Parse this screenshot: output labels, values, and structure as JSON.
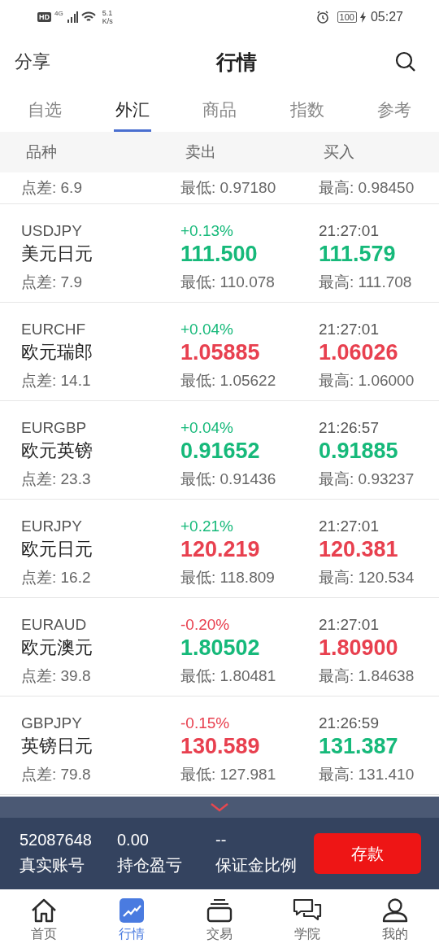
{
  "status_bar": {
    "hd": "HD",
    "network": "4G",
    "speed": "5.1",
    "speed_unit": "K/s",
    "battery": "100",
    "time": "05:27"
  },
  "header": {
    "left": "分享",
    "title": "行情"
  },
  "tabs": [
    {
      "label": "自选",
      "selected": false
    },
    {
      "label": "外汇",
      "selected": true
    },
    {
      "label": "商品",
      "selected": false
    },
    {
      "label": "指数",
      "selected": false
    },
    {
      "label": "参考",
      "selected": false
    }
  ],
  "columns": [
    "品种",
    "卖出",
    "买入"
  ],
  "partial_row": {
    "spread": "点差: 6.9",
    "low": "最低: 0.97180",
    "high": "最高: 0.98450"
  },
  "rows": [
    {
      "code": "USDJPY",
      "name": "美元日元",
      "spread": "点差: 7.9",
      "change": {
        "text": "+0.13%",
        "color": "#16b97a"
      },
      "sell": {
        "text": "111.500",
        "color": "#16b97a"
      },
      "low": "最低: 110.078",
      "time": "21:27:01",
      "buy": {
        "text": "111.579",
        "color": "#16b97a"
      },
      "high": "最高: 111.708"
    },
    {
      "code": "EURCHF",
      "name": "欧元瑞郎",
      "spread": "点差: 14.1",
      "change": {
        "text": "+0.04%",
        "color": "#16b97a"
      },
      "sell": {
        "text": "1.05885",
        "color": "#e8404f"
      },
      "low": "最低: 1.05622",
      "time": "21:27:01",
      "buy": {
        "text": "1.06026",
        "color": "#e8404f"
      },
      "high": "最高: 1.06000"
    },
    {
      "code": "EURGBP",
      "name": "欧元英镑",
      "spread": "点差: 23.3",
      "change": {
        "text": "+0.04%",
        "color": "#16b97a"
      },
      "sell": {
        "text": "0.91652",
        "color": "#16b97a"
      },
      "low": "最低: 0.91436",
      "time": "21:26:57",
      "buy": {
        "text": "0.91885",
        "color": "#16b97a"
      },
      "high": "最高: 0.93237"
    },
    {
      "code": "EURJPY",
      "name": "欧元日元",
      "spread": "点差: 16.2",
      "change": {
        "text": "+0.21%",
        "color": "#16b97a"
      },
      "sell": {
        "text": "120.219",
        "color": "#e8404f"
      },
      "low": "最低: 118.809",
      "time": "21:27:01",
      "buy": {
        "text": "120.381",
        "color": "#e8404f"
      },
      "high": "最高: 120.534"
    },
    {
      "code": "EURAUD",
      "name": "欧元澳元",
      "spread": "点差: 39.8",
      "change": {
        "text": "-0.20%",
        "color": "#e8404f"
      },
      "sell": {
        "text": "1.80502",
        "color": "#16b97a"
      },
      "low": "最低: 1.80481",
      "time": "21:27:01",
      "buy": {
        "text": "1.80900",
        "color": "#e8404f"
      },
      "high": "最高: 1.84638"
    },
    {
      "code": "GBPJPY",
      "name": "英镑日元",
      "spread": "点差: 79.8",
      "change": {
        "text": "-0.15%",
        "color": "#e8404f"
      },
      "sell": {
        "text": "130.589",
        "color": "#e8404f"
      },
      "low": "最低: 127.981",
      "time": "21:26:59",
      "buy": {
        "text": "131.387",
        "color": "#16b97a"
      },
      "high": "最高: 131.410"
    }
  ],
  "account": {
    "number": "52087648",
    "number_label": "真实账号",
    "pnl": "0.00",
    "pnl_label": "持仓盈亏",
    "margin": "--",
    "margin_label": "保证金比例",
    "deposit": "存款"
  },
  "nav": [
    {
      "label": "首页",
      "selected": false
    },
    {
      "label": "行情",
      "selected": true
    },
    {
      "label": "交易",
      "selected": false
    },
    {
      "label": "学院",
      "selected": false
    },
    {
      "label": "我的",
      "selected": false
    }
  ]
}
